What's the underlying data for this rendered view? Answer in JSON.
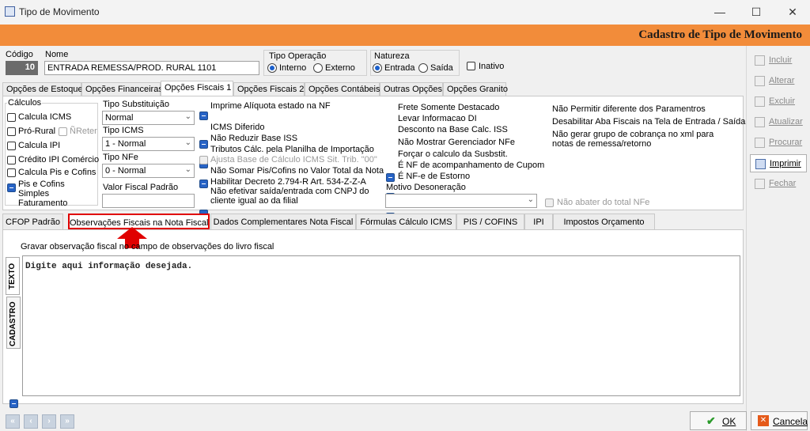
{
  "window": {
    "title": "Tipo de Movimento",
    "min": "—",
    "max": "☐",
    "close": "✕"
  },
  "header": {
    "title": "Cadastro de Tipo de Movimento"
  },
  "form": {
    "codigo_label": "Código",
    "codigo_value": "10",
    "nome_label": "Nome",
    "nome_value": "ENTRADA REMESSA/PROD. RURAL 1101",
    "tipo_operacao_label": "Tipo Operação",
    "interno": "Interno",
    "externo": "Externo",
    "natureza_label": "Natureza",
    "entrada": "Entrada",
    "saida": "Saída",
    "inativo": "Inativo"
  },
  "tabs": [
    "Opções de Estoque",
    "Opções Financeiras",
    "Opções Fiscais 1",
    "Opções Fiscais 2",
    "Opções Contábeis",
    "Outras Opções",
    "Opções Granito"
  ],
  "fiscal": {
    "calculos_title": "Cálculos",
    "calculos": [
      "Calcula ICMS",
      "Pró-Rural",
      "ÑReter",
      "Calcula IPI",
      "Crédito IPI Comércio",
      "Calcula Pis e Cofins"
    ],
    "pis_simples": "Pis e Cofins Simples Faturamento",
    "tipo_subst_label": "Tipo Substituição",
    "tipo_subst_value": "Normal",
    "tipo_icms_label": "Tipo ICMS",
    "tipo_icms_value": "1 - Normal",
    "tipo_nfe_label": "Tipo NFe",
    "tipo_nfe_value": "0 - Normal",
    "valor_fiscal_label": "Valor Fiscal Padrão",
    "col3": [
      "Imprime Alíquota estado na NF",
      "ICMS Diferido",
      "Não Reduzir Base ISS",
      "Tributos Cálc. pela Planilha de Importação",
      "Ajusta Base de Cálculo ICMS Sit. Trib. \"00\"",
      "Não Somar Pis/Cofins no Valor Total da Nota",
      "Habilitar Decreto 2.794-R Art. 534-Z-Z-A",
      "Não efetivar saída/entrada com CNPJ do cliente igual ao da filial"
    ],
    "col4": [
      "Frete Somente Destacado",
      "Levar Informacao DI",
      "Desconto na Base Calc. ISS",
      "Não Mostrar Gerenciador NFe",
      "Forçar o calculo da Susbstit.",
      "É NF de acompanhamento de Cupom",
      "É NF-e de Estorno"
    ],
    "motivo_label": "Motivo Desoneração",
    "col5": [
      "Não Permitir diferente dos Paramentros",
      "Desabilitar Aba Fiscais na Tela de Entrada / Saída",
      "Não gerar grupo de cobrança no xml para notas de remessa/retorno"
    ],
    "nao_abater": "Não abater do total NFe"
  },
  "bottom_tabs": [
    "CFOP Padrão",
    "Observações Fiscais na Nota Fiscal",
    "Dados Complementares Nota Fiscal",
    "Fórmulas Cálculo ICMS",
    "PIS / COFINS",
    "IPI",
    "Impostos Orçamento"
  ],
  "obs": {
    "gravar": "Gravar observação fiscal no campo de observações do livro fiscal",
    "text": "Digite aqui informação desejada.",
    "vtab_texto": "TEXTO",
    "vtab_cadastro": "CADASTRO"
  },
  "side": [
    "Incluir",
    "Alterar",
    "Excluir",
    "Atualizar",
    "Procurar",
    "Imprimir",
    "Fechar"
  ],
  "footer": {
    "ok": "OK",
    "cancel": "Cancela",
    "nav": [
      "«",
      "‹",
      "›",
      "»"
    ]
  },
  "colors": {
    "orange": "#f28c3a",
    "highlight": "#e00000",
    "check": "#2763c6"
  }
}
